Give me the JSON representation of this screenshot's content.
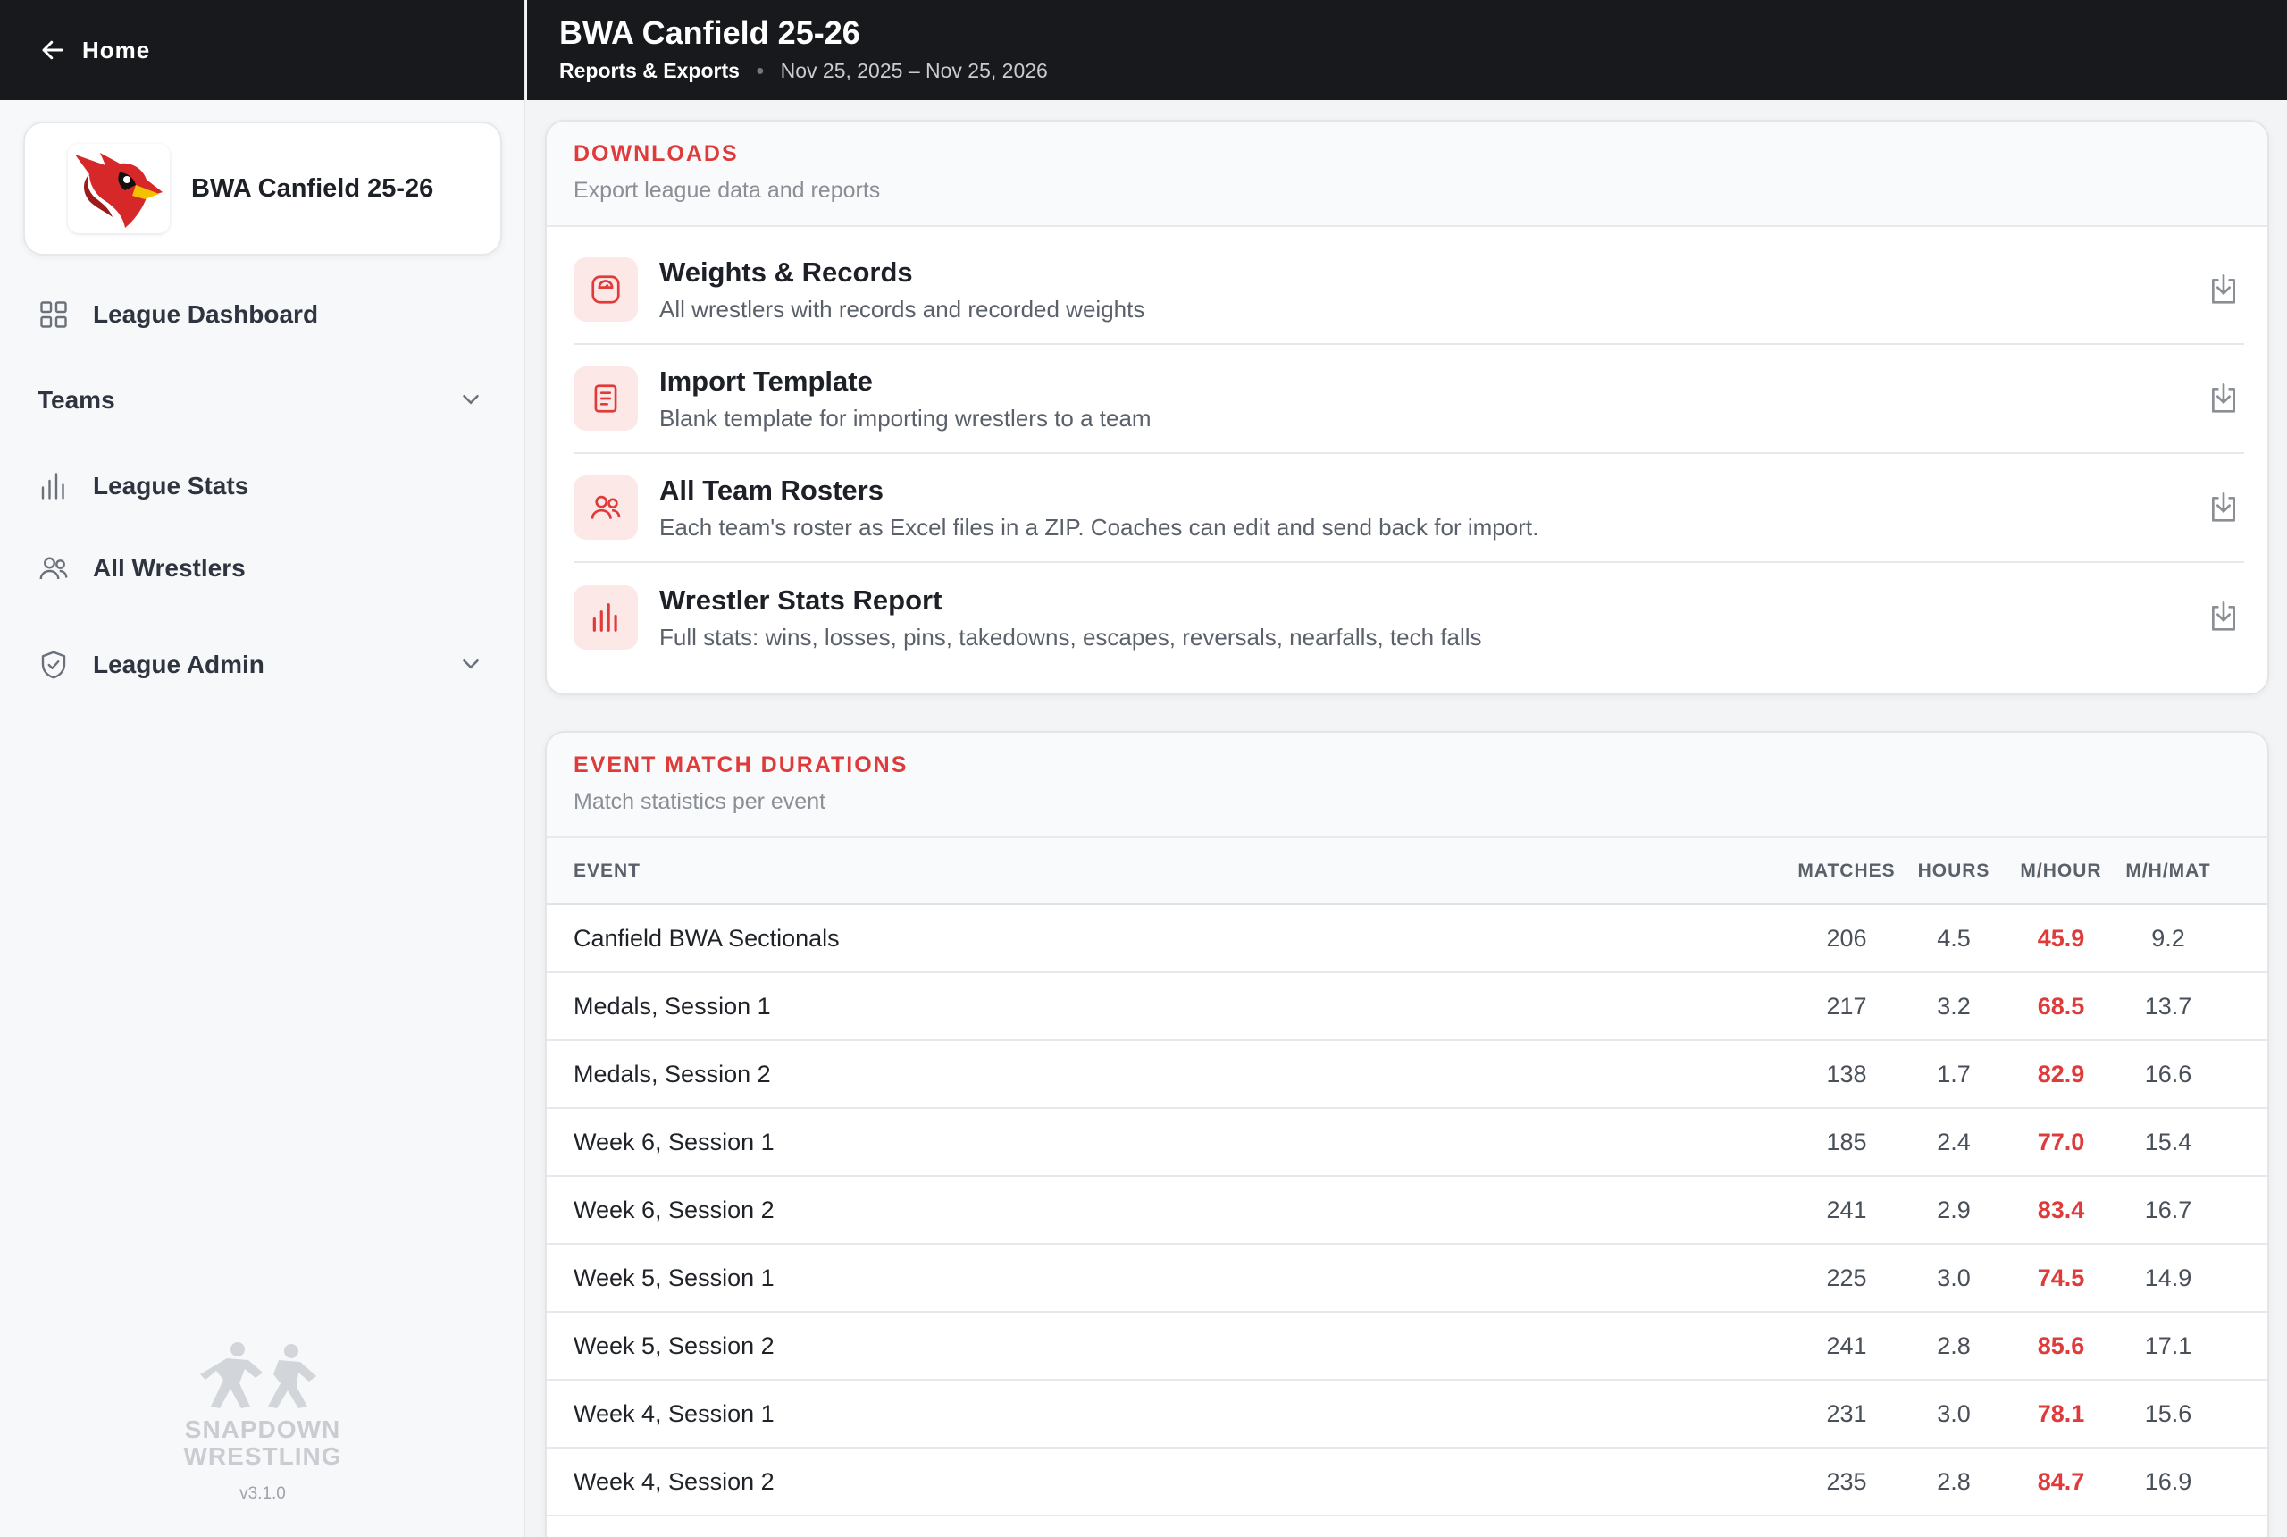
{
  "sidebar": {
    "home_label": "Home",
    "league_name": "BWA Canfield 25-26",
    "nav": {
      "dashboard": "League Dashboard",
      "teams": "Teams",
      "stats": "League Stats",
      "wrestlers": "All Wrestlers",
      "admin": "League Admin"
    },
    "brand_line1": "SNAPDOWN",
    "brand_line2": "WRESTLING",
    "version": "v3.1.0"
  },
  "header": {
    "title": "BWA Canfield 25-26",
    "breadcrumb": "Reports & Exports",
    "date_range": "Nov 25, 2025 – Nov 25, 2026"
  },
  "downloads": {
    "title": "DOWNLOADS",
    "subtitle": "Export league data and reports",
    "items": [
      {
        "title": "Weights & Records",
        "desc": "All wrestlers with records and recorded weights",
        "icon": "scale-icon"
      },
      {
        "title": "Import Template",
        "desc": "Blank template for importing wrestlers to a team",
        "icon": "document-icon"
      },
      {
        "title": "All Team Rosters",
        "desc": "Each team's roster as Excel files in a ZIP. Coaches can edit and send back for import.",
        "icon": "users-icon"
      },
      {
        "title": "Wrestler Stats Report",
        "desc": "Full stats: wins, losses, pins, takedowns, escapes, reversals, nearfalls, tech falls",
        "icon": "bar-chart-icon"
      }
    ]
  },
  "durations": {
    "title": "EVENT MATCH DURATIONS",
    "subtitle": "Match statistics per event",
    "columns": [
      "EVENT",
      "MATCHES",
      "HOURS",
      "M/HOUR",
      "M/H/MAT"
    ],
    "rows": [
      [
        "Canfield BWA Sectionals",
        "206",
        "4.5",
        "45.9",
        "9.2"
      ],
      [
        "Medals, Session 1",
        "217",
        "3.2",
        "68.5",
        "13.7"
      ],
      [
        "Medals, Session 2",
        "138",
        "1.7",
        "82.9",
        "16.6"
      ],
      [
        "Week 6, Session 1",
        "185",
        "2.4",
        "77.0",
        "15.4"
      ],
      [
        "Week 6, Session 2",
        "241",
        "2.9",
        "83.4",
        "16.7"
      ],
      [
        "Week 5, Session 1",
        "225",
        "3.0",
        "74.5",
        "14.9"
      ],
      [
        "Week 5, Session 2",
        "241",
        "2.8",
        "85.6",
        "17.1"
      ],
      [
        "Week 4, Session 1",
        "231",
        "3.0",
        "78.1",
        "15.6"
      ],
      [
        "Week 4, Session 2",
        "235",
        "2.8",
        "84.7",
        "16.9"
      ]
    ]
  },
  "colors": {
    "accent": "#e03b3b",
    "dark": "#18191c",
    "icon_bg": "#fde8e8"
  }
}
